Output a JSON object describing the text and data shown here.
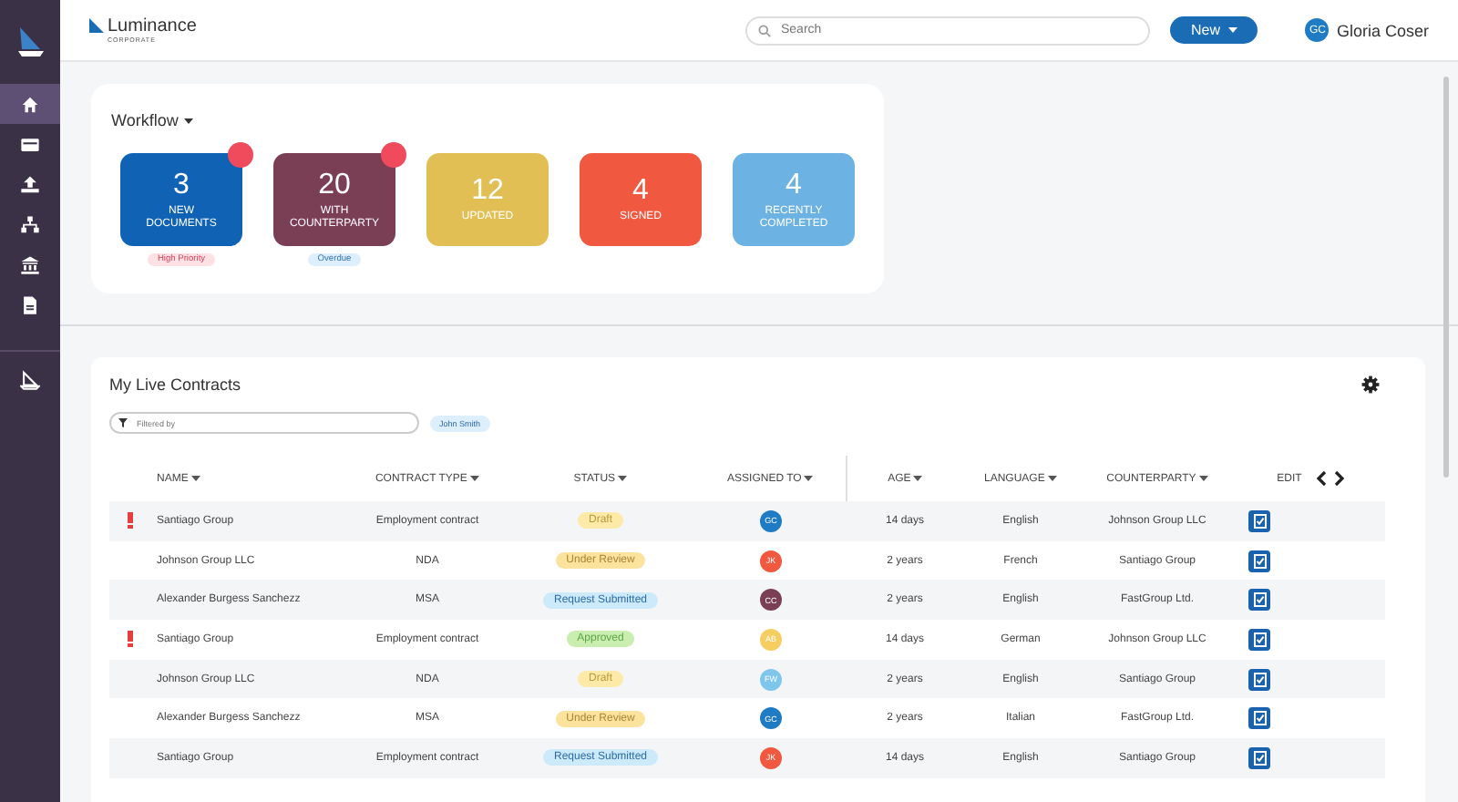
{
  "sidebar": {
    "items": [
      {
        "selected": true
      },
      {
        "selected": false
      },
      {
        "selected": false
      },
      {
        "selected": false
      },
      {
        "selected": false
      },
      {
        "selected": false
      }
    ]
  },
  "header": {
    "logo": "Luminance",
    "logo_sub": "CORPORATE",
    "search": {
      "placeholder": "Search"
    },
    "new_button": "New",
    "user": {
      "initials": "GC",
      "name": "Gloria Coser"
    }
  },
  "workflow": {
    "title": "Workflow",
    "tiles": [
      {
        "count": "3",
        "label": "NEW DOCUMENTS",
        "color": "#0f62b4",
        "alert": true,
        "tag": {
          "label": "High Priority",
          "kind": "priority"
        }
      },
      {
        "count": "20",
        "label": "WITH COUNTERPARTY",
        "color": "#7b3f55",
        "alert": true,
        "tag": {
          "label": "Overdue",
          "kind": "overdue"
        }
      },
      {
        "count": "12",
        "label": "UPDATED",
        "color": "#e2bf55",
        "alert": false
      },
      {
        "count": "4",
        "label": "SIGNED",
        "color": "#f0583f",
        "alert": false
      },
      {
        "count": "4",
        "label": "RECENTLY COMPLETED",
        "color": "#6cb3e3",
        "alert": false
      }
    ]
  },
  "contracts": {
    "title": "My Live Contracts",
    "filter": {
      "placeholder": "Filtered by"
    },
    "filter_chip": "John Smith",
    "columns": [
      "NAME",
      "CONTRACT TYPE",
      "STATUS",
      "ASSIGNED TO",
      "AGE",
      "LANGUAGE",
      "COUNTERPARTY",
      "EDIT"
    ],
    "rows": [
      {
        "flagged": true,
        "name": "Santiago Group",
        "type": "Employment contract",
        "status": {
          "label": "Draft",
          "kind": "draft"
        },
        "assignee": {
          "initials": "GC",
          "color": "#1f7bc4"
        },
        "age": "14 days",
        "language": "English",
        "counterparty": "Johnson Group LLC"
      },
      {
        "flagged": false,
        "name": "Johnson Group LLC",
        "type": "NDA",
        "status": {
          "label": "Under Review",
          "kind": "review"
        },
        "assignee": {
          "initials": "JK",
          "color": "#f0583f"
        },
        "age": "2 years",
        "language": "French",
        "counterparty": "Santiago Group"
      },
      {
        "flagged": false,
        "name": "Alexander Burgess Sanchezz",
        "type": "MSA",
        "status": {
          "label": "Request Submitted",
          "kind": "submitted"
        },
        "assignee": {
          "initials": "CC",
          "color": "#7b3f55"
        },
        "age": "2 years",
        "language": "English",
        "counterparty": "FastGroup Ltd."
      },
      {
        "flagged": true,
        "name": "Santiago Group",
        "type": "Employment contract",
        "status": {
          "label": "Approved",
          "kind": "approved"
        },
        "assignee": {
          "initials": "AB",
          "color": "#f5cd60"
        },
        "age": "14 days",
        "language": "German",
        "counterparty": "Johnson Group LLC"
      },
      {
        "flagged": false,
        "name": "Johnson Group LLC",
        "type": "NDA",
        "status": {
          "label": "Draft",
          "kind": "draft"
        },
        "assignee": {
          "initials": "FW",
          "color": "#7fc6ec"
        },
        "age": "2 years",
        "language": "English",
        "counterparty": "Santiago Group"
      },
      {
        "flagged": false,
        "name": "Alexander Burgess Sanchezz",
        "type": "MSA",
        "status": {
          "label": "Under Review",
          "kind": "review"
        },
        "assignee": {
          "initials": "GC",
          "color": "#1f7bc4"
        },
        "age": "2 years",
        "language": "Italian",
        "counterparty": "FastGroup Ltd."
      },
      {
        "flagged": false,
        "name": "Santiago Group",
        "type": "Employment contract",
        "status": {
          "label": "Request Submitted",
          "kind": "submitted"
        },
        "assignee": {
          "initials": "JK",
          "color": "#f0583f"
        },
        "age": "14 days",
        "language": "English",
        "counterparty": "Santiago Group"
      }
    ]
  }
}
